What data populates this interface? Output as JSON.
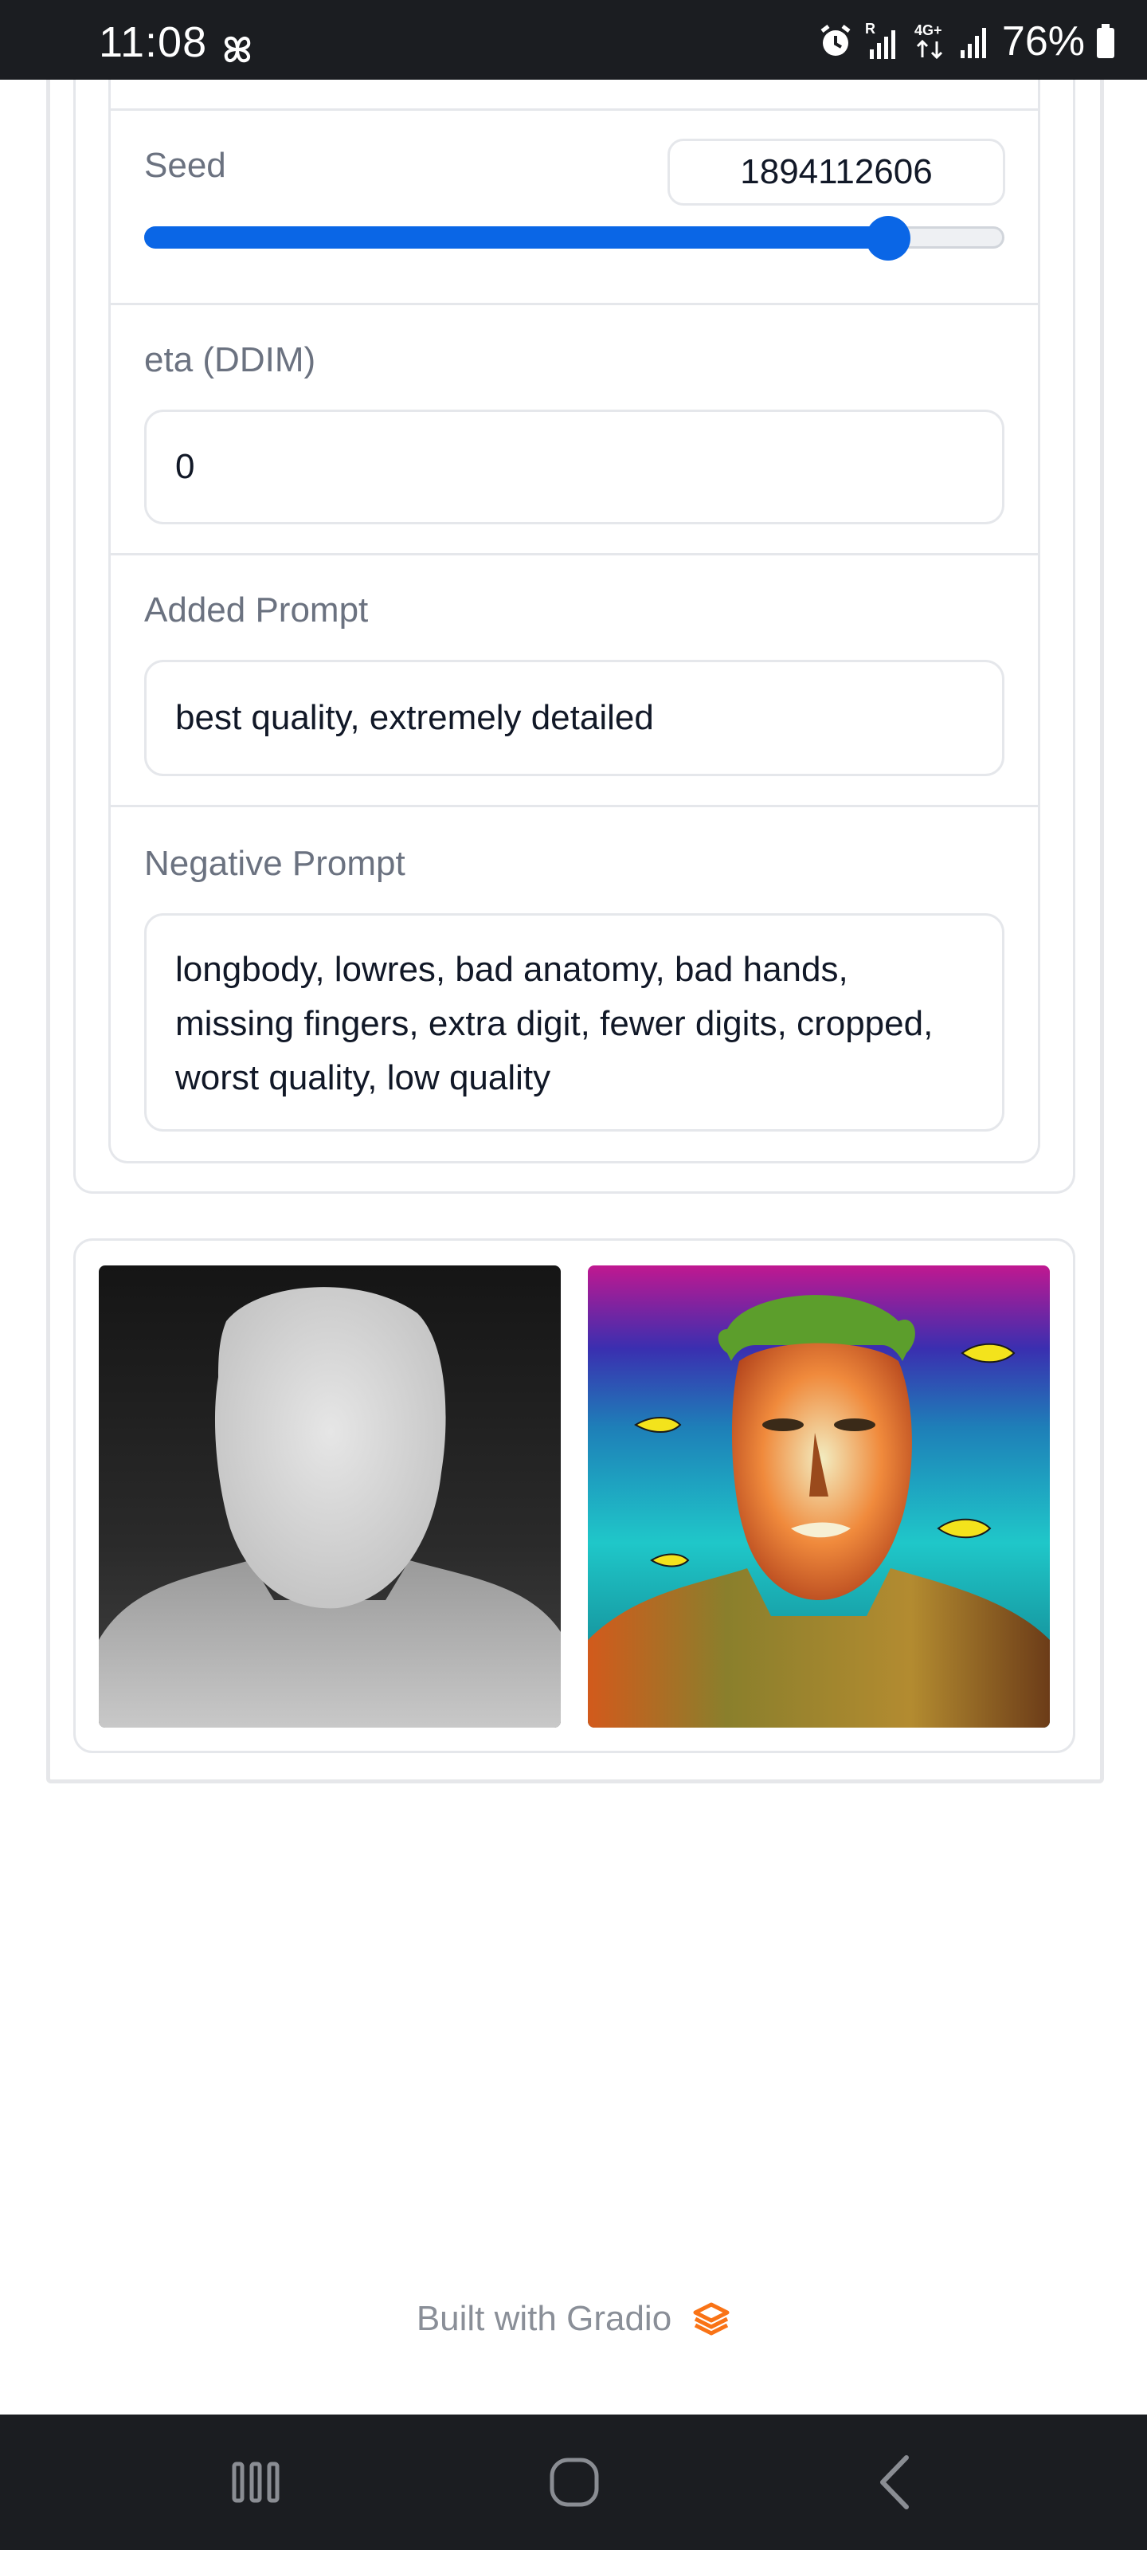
{
  "status_bar": {
    "time": "11:08",
    "battery": "76%",
    "network": "4G+",
    "icons": [
      "pinwheel-icon",
      "alarm-icon",
      "signal-roaming-icon",
      "data-4g-icon",
      "signal-icon",
      "battery-icon"
    ]
  },
  "settings": {
    "seed": {
      "label": "Seed",
      "value": "1894112606",
      "slider_fraction": 0.865
    },
    "eta": {
      "label": "eta (DDIM)",
      "value": "0"
    },
    "added_prompt": {
      "label": "Added Prompt",
      "value": "best quality, extremely detailed"
    },
    "negative_prompt": {
      "label": "Negative Prompt",
      "value": "longbody, lowres, bad anatomy, bad hands, missing fingers, extra digit, fewer digits, cropped, worst quality, low quality"
    }
  },
  "gallery": {
    "images": [
      "depth-map-image",
      "generated-underwater-portrait-image"
    ]
  },
  "footer": {
    "text": "Built with Gradio",
    "icon": "gradio-logo-icon",
    "color": "#f97316"
  },
  "nav_bar": {
    "buttons": [
      "recent-apps-button",
      "home-button",
      "back-button"
    ]
  },
  "colors": {
    "accent": "#0a66e6",
    "status_bar_bg": "#1b1d21"
  }
}
